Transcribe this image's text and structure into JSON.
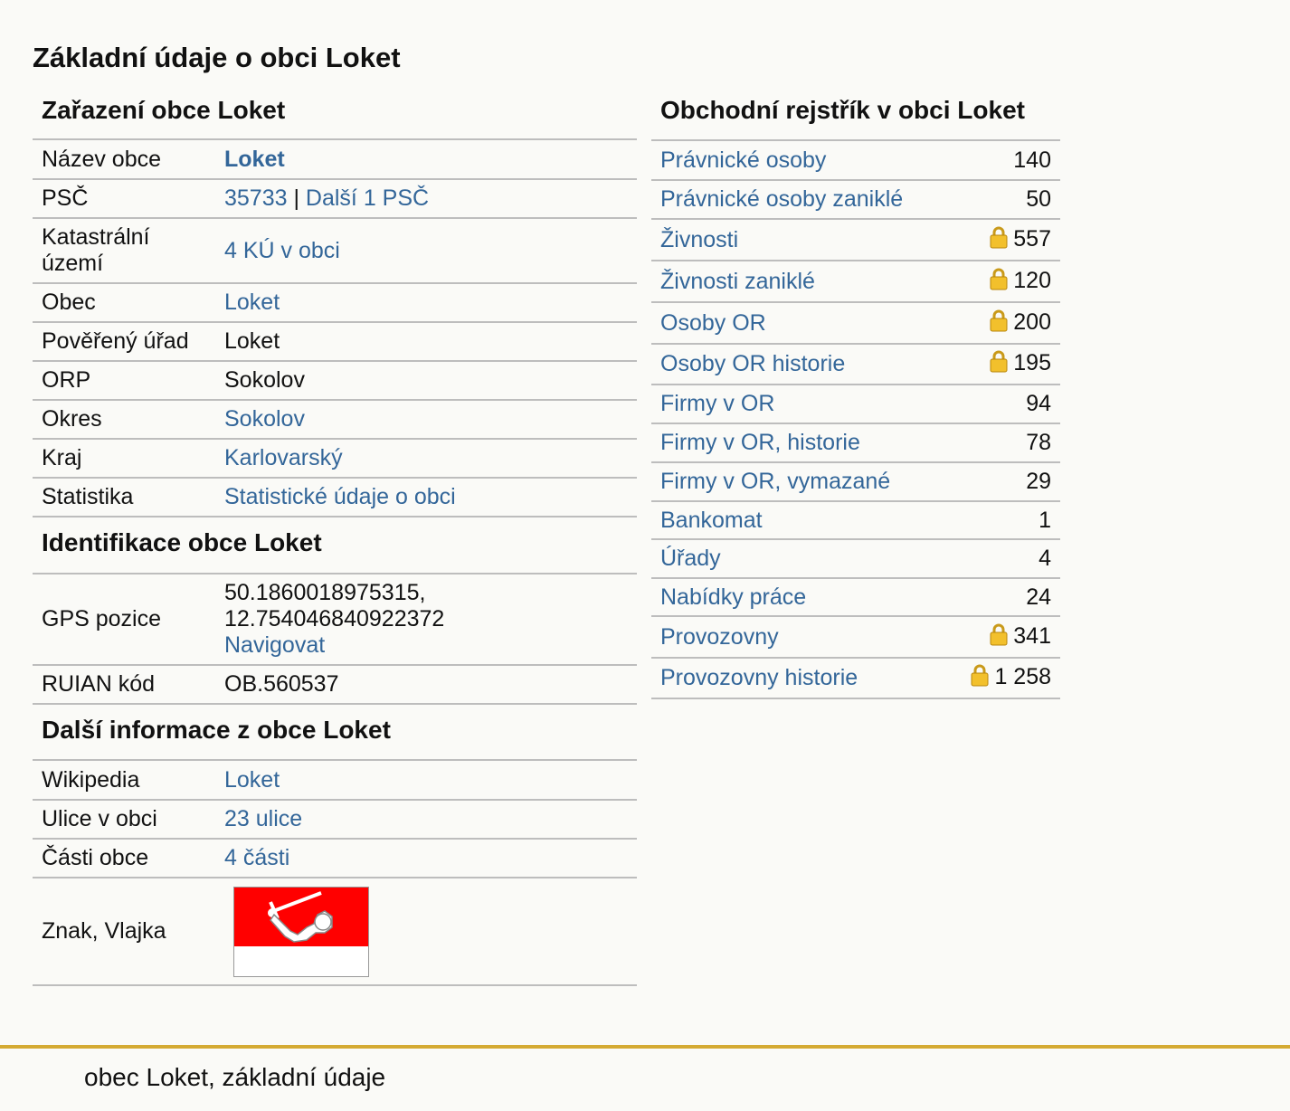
{
  "page_title": "Základní údaje o obci Loket",
  "zarazeni": {
    "title": "Zařazení obce Loket",
    "nazev": {
      "label": "Název obce",
      "value": "Loket"
    },
    "psc": {
      "label": "PSČ",
      "value": "35733",
      "separator": " | ",
      "more": "Další 1 PSČ"
    },
    "katastr": {
      "label": "Katastrální území",
      "value": "4 KÚ v obci"
    },
    "obec": {
      "label": "Obec",
      "value": "Loket"
    },
    "povereny": {
      "label": "Pověřený úřad",
      "value": "Loket"
    },
    "orp": {
      "label": "ORP",
      "value": "Sokolov"
    },
    "okres": {
      "label": "Okres",
      "value": "Sokolov"
    },
    "kraj": {
      "label": "Kraj",
      "value": "Karlovarský"
    },
    "statistika": {
      "label": "Statistika",
      "value": "Statistické údaje o obci"
    }
  },
  "identifikace": {
    "title": "Identifikace obce Loket",
    "gps": {
      "label": "GPS pozice",
      "lat": "50.1860018975315,",
      "lon": "12.754046840922372",
      "nav": "Navigovat"
    },
    "ruian": {
      "label": "RUIAN kód",
      "value": "OB.560537"
    }
  },
  "dalsi": {
    "title": "Další informace z obce Loket",
    "wikipedia": {
      "label": "Wikipedia",
      "value": "Loket"
    },
    "ulice": {
      "label": "Ulice v obci",
      "value": "23 ulice"
    },
    "casti": {
      "label": "Části obce",
      "value": "4 části"
    },
    "znak": {
      "label": "Znak, Vlajka"
    }
  },
  "rejstrik": {
    "title": "Obchodní rejstřík v obci Loket",
    "rows": [
      {
        "label": "Právnické osoby",
        "value": "140",
        "locked": false
      },
      {
        "label": "Právnické osoby zaniklé",
        "value": "50",
        "locked": false
      },
      {
        "label": "Živnosti",
        "value": "557",
        "locked": true
      },
      {
        "label": "Živnosti zaniklé",
        "value": "120",
        "locked": true
      },
      {
        "label": "Osoby OR",
        "value": "200",
        "locked": true
      },
      {
        "label": "Osoby OR historie",
        "value": "195",
        "locked": true
      },
      {
        "label": "Firmy v OR",
        "value": "94",
        "locked": false
      },
      {
        "label": "Firmy v OR, historie",
        "value": "78",
        "locked": false
      },
      {
        "label": "Firmy v OR, vymazané",
        "value": "29",
        "locked": false
      },
      {
        "label": "Bankomat",
        "value": "1",
        "locked": false
      },
      {
        "label": "Úřady",
        "value": "4",
        "locked": false
      },
      {
        "label": "Nabídky práce",
        "value": "24",
        "locked": false
      },
      {
        "label": "Provozovny",
        "value": "341",
        "locked": true
      },
      {
        "label": "Provozovny historie",
        "value": "1 258",
        "locked": true
      }
    ]
  },
  "flag_colors": {
    "top": "#ff0000",
    "bottom": "#ffffff"
  },
  "accent_color": "#d4aa33",
  "link_color": "#336699",
  "footer": {
    "text": "obec Loket, základní údaje"
  }
}
